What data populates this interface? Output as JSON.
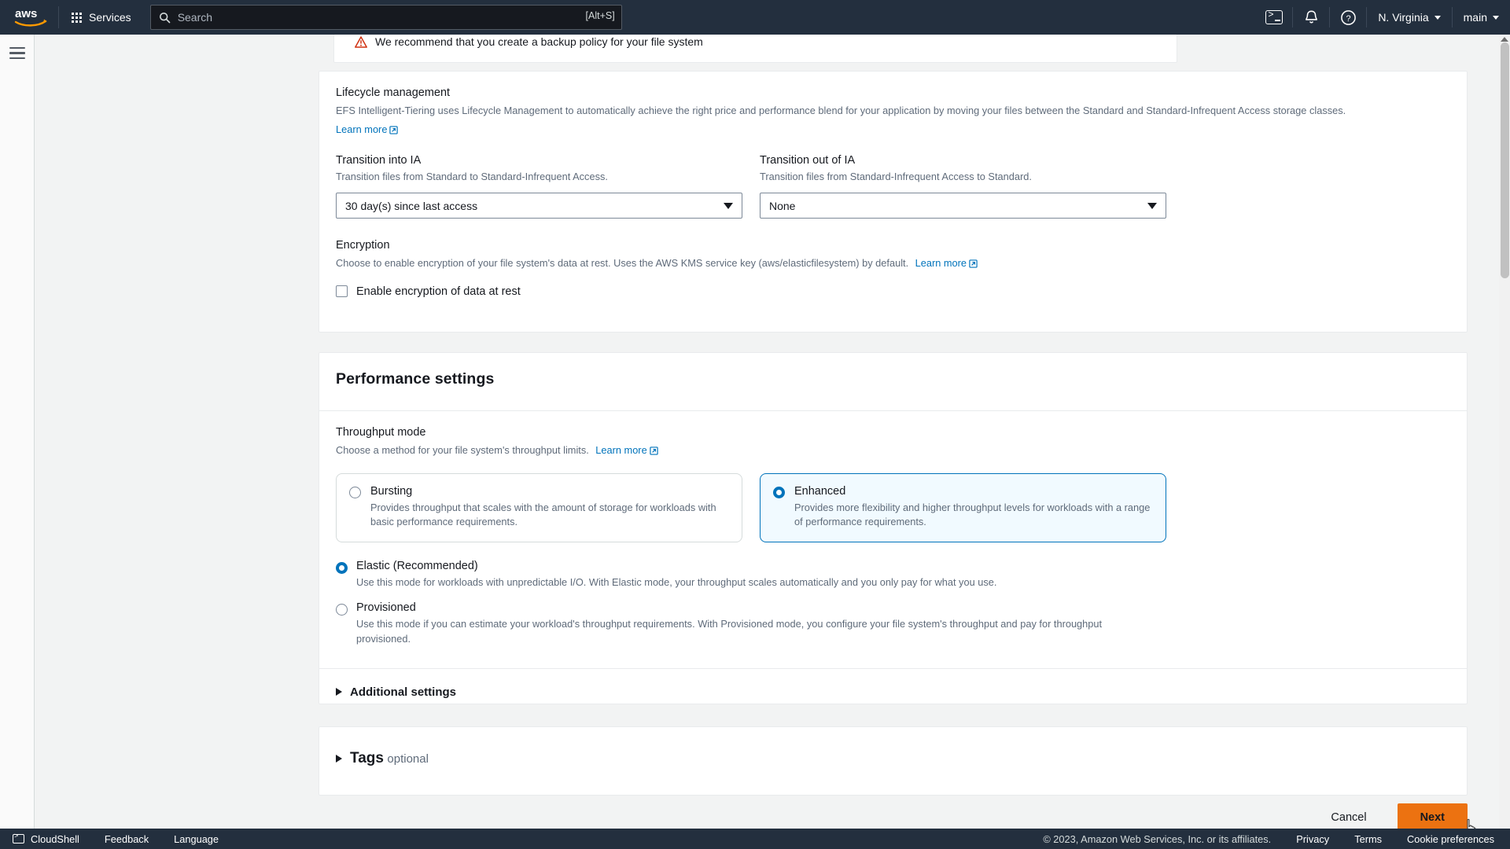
{
  "topnav": {
    "logo_alt": "aws",
    "services_label": "Services",
    "search_placeholder": "Search",
    "search_shortcut": "[Alt+S]",
    "cloudshell_icon": "cloudshell-icon",
    "notifications_icon": "bell-icon",
    "help_icon": "help-circle-icon",
    "region_label": "N. Virginia",
    "account_label": "main"
  },
  "alert": {
    "icon": "warning-triangle-icon",
    "message": "We recommend that you create a backup policy for your file system"
  },
  "lifecycle": {
    "title": "Lifecycle management",
    "description": "EFS Intelligent-Tiering uses Lifecycle Management to automatically achieve the right price and performance blend for your application by moving your files between the Standard and Standard-Infrequent Access storage classes.",
    "learn_more": "Learn more",
    "transition_into": {
      "label": "Transition into IA",
      "description": "Transition files from Standard to Standard-Infrequent Access.",
      "value": "30 day(s) since last access"
    },
    "transition_out": {
      "label": "Transition out of IA",
      "description": "Transition files from Standard-Infrequent Access to Standard.",
      "value": "None"
    }
  },
  "encryption": {
    "title": "Encryption",
    "description": "Choose to enable encryption of your file system's data at rest. Uses the AWS KMS service key (aws/elasticfilesystem) by default.",
    "learn_more": "Learn more",
    "checkbox_label": "Enable encryption of data at rest",
    "checked": false
  },
  "performance": {
    "title": "Performance settings",
    "throughput_mode": {
      "label": "Throughput mode",
      "description": "Choose a method for your file system's throughput limits.",
      "learn_more": "Learn more",
      "cards": [
        {
          "title": "Bursting",
          "description": "Provides throughput that scales with the amount of storage for workloads with basic performance requirements.",
          "selected": false
        },
        {
          "title": "Enhanced",
          "description": "Provides more flexibility and higher throughput levels for workloads with a range of performance requirements.",
          "selected": true
        }
      ],
      "options": [
        {
          "title": "Elastic (Recommended)",
          "description": "Use this mode for workloads with unpredictable I/O. With Elastic mode, your throughput scales automatically and you only pay for what you use.",
          "selected": true
        },
        {
          "title": "Provisioned",
          "description": "Use this mode if you can estimate your workload's throughput requirements. With Provisioned mode, you configure your file system's throughput and pay for throughput provisioned.",
          "selected": false
        }
      ]
    },
    "additional_settings_label": "Additional settings",
    "additional_settings_expanded": false
  },
  "tags": {
    "title": "Tags",
    "optional_label": "optional",
    "expanded": false
  },
  "actions": {
    "cancel_label": "Cancel",
    "next_label": "Next"
  },
  "footer": {
    "cloudshell_label": "CloudShell",
    "feedback_label": "Feedback",
    "language_label": "Language",
    "copyright": "© 2023, Amazon Web Services, Inc. or its affiliates.",
    "privacy_label": "Privacy",
    "terms_label": "Terms",
    "cookie_label": "Cookie preferences"
  },
  "colors": {
    "nav_bg": "#232f3e",
    "accent_orange": "#ec7211",
    "link_blue": "#0073bb",
    "warn_red": "#d13212"
  }
}
